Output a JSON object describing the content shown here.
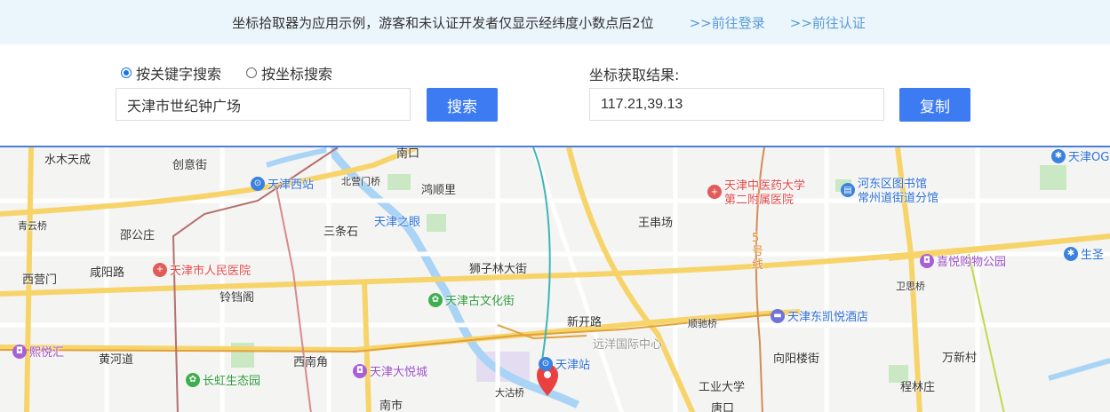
{
  "notice": {
    "message": "坐标拾取器为应用示例，游客和未认证开发者仅显示经纬度小数点后2位",
    "login_link": ">>前往登录",
    "verify_link": ">>前往认证"
  },
  "search": {
    "mode_keyword_label": "按关键字搜索",
    "mode_coord_label": "按坐标搜索",
    "selected_mode": "keyword",
    "keyword_value": "天津市世纪钟广场",
    "search_button": "搜索"
  },
  "result": {
    "label": "坐标获取结果:",
    "value": "117.21,39.13",
    "copy_button": "复制"
  },
  "map": {
    "labels": {
      "shuimu": "水木天成",
      "chuangyi": "创意街",
      "nankou": "南口",
      "beiying": "北营门桥",
      "hongshun": "鸿顺里",
      "qingyun": "青云桥",
      "shaogong": "邵公庄",
      "santiao": "三条石",
      "tianjinzhiyan": "天津之眼",
      "wangchuan": "王串场",
      "xiying": "西营门",
      "xianyang": "咸阳路",
      "shizilin": "狮子林大街",
      "lingdang": "铃铛阁",
      "xinkai": "新开路",
      "yuanyang": "远洋国际中心",
      "shunchi": "顺驰桥",
      "weiyan": "卫思桥",
      "huanghe": "黄河道",
      "xinanjiao": "西南角",
      "xiangyang": "向阳楼街",
      "wanxin": "万新村",
      "dagu": "大沽桥",
      "gongye": "工业大学",
      "chenglin": "程林庄",
      "nanshi": "南市",
      "tangkou": "唐口",
      "line5": "5号线"
    },
    "pois": {
      "xizhan": "天津西站",
      "zhongyi1": "天津中医药大学",
      "zhongyi2": "第二附属医院",
      "hedong1": "河东区图书馆",
      "hedong2": "常州道街道分馆",
      "renmin": "天津市人民医院",
      "guwenhua": "天津古文化街",
      "xiyue": "喜悦购物公园",
      "kairui": "天津东凯悦酒店",
      "xiyuehui": "熙悦汇",
      "dayuecheng": "天津大悦城",
      "tianjinzhan": "天津站",
      "changhong": "长虹生态园",
      "og": "天津OG",
      "shengsheng": "生圣"
    }
  }
}
